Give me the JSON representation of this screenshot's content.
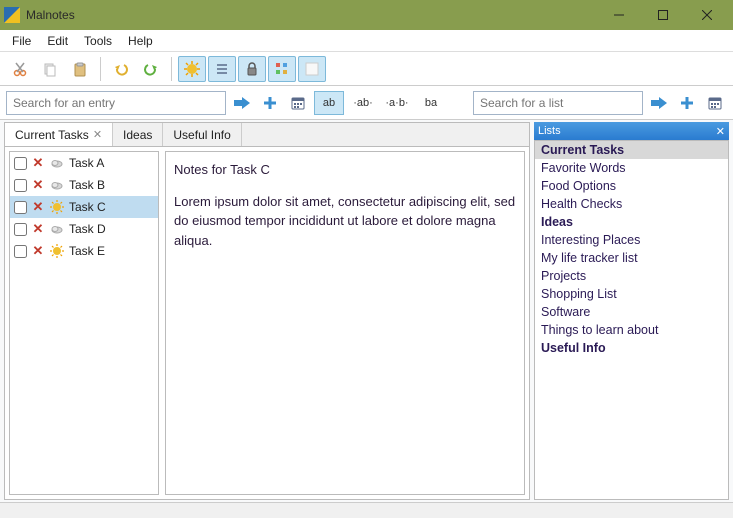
{
  "window": {
    "title": "Malnotes"
  },
  "menu": {
    "items": [
      "File",
      "Edit",
      "Tools",
      "Help"
    ]
  },
  "search": {
    "entry_placeholder": "Search for an entry",
    "list_placeholder": "Search for a list",
    "format_ab": "ab",
    "format_dota": "·ab·",
    "format_abdot": "·a·b·",
    "format_ba": "ba"
  },
  "tabs": [
    {
      "label": "Current Tasks",
      "closable": true,
      "active": true
    },
    {
      "label": "Ideas",
      "closable": false,
      "active": false
    },
    {
      "label": "Useful Info",
      "closable": false,
      "active": false
    }
  ],
  "tasks": [
    {
      "name": "Task A",
      "sun": false,
      "selected": false
    },
    {
      "name": "Task B",
      "sun": false,
      "selected": false
    },
    {
      "name": "Task C",
      "sun": true,
      "selected": true
    },
    {
      "name": "Task D",
      "sun": false,
      "selected": false
    },
    {
      "name": "Task E",
      "sun": true,
      "selected": false
    }
  ],
  "note": {
    "title": "Notes for Task C",
    "body": "Lorem ipsum dolor sit amet, consectetur adipiscing elit, sed do eiusmod tempor incididunt ut labore et dolore magna aliqua."
  },
  "lists": {
    "header": "Lists",
    "items": [
      {
        "name": "Current Tasks",
        "bold": true,
        "selected": true
      },
      {
        "name": "Favorite Words",
        "bold": false,
        "selected": false
      },
      {
        "name": "Food Options",
        "bold": false,
        "selected": false
      },
      {
        "name": "Health Checks",
        "bold": false,
        "selected": false
      },
      {
        "name": "Ideas",
        "bold": true,
        "selected": false
      },
      {
        "name": "Interesting Places",
        "bold": false,
        "selected": false
      },
      {
        "name": "My life tracker list",
        "bold": false,
        "selected": false
      },
      {
        "name": "Projects",
        "bold": false,
        "selected": false
      },
      {
        "name": "Shopping List",
        "bold": false,
        "selected": false
      },
      {
        "name": "Software",
        "bold": false,
        "selected": false
      },
      {
        "name": "Things to learn about",
        "bold": false,
        "selected": false
      },
      {
        "name": "Useful Info",
        "bold": true,
        "selected": false
      }
    ]
  }
}
